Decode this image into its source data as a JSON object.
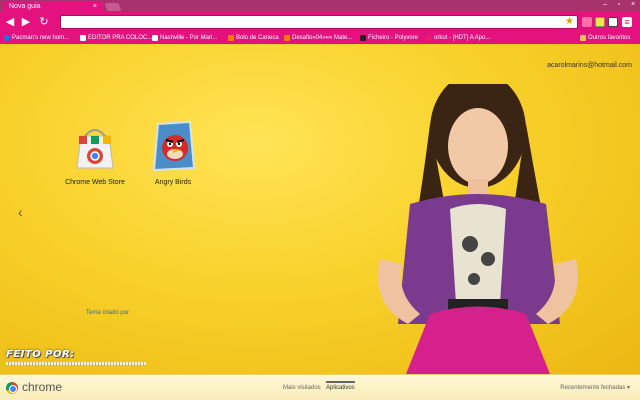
{
  "tabstrip": {
    "active_tab": "Nova guia",
    "close_glyph": "×",
    "window_controls": [
      "–",
      "▫",
      "×"
    ]
  },
  "toolbar": {
    "back_icon": "◀",
    "forward_icon": "▶",
    "reload_icon": "↻",
    "omnibox_value": "",
    "star_icon": "★"
  },
  "bookmarks": {
    "items": [
      {
        "label": "Pacman's new hom...",
        "favicon_color": "#1a73e8"
      },
      {
        "label": "EDITOR PRA COLOC...",
        "favicon_color": "#ffffff"
      },
      {
        "label": "Nashville - Por Mari...",
        "favicon_color": "#ffffff"
      },
      {
        "label": "Bolo de Caneca",
        "favicon_color": "#f57c00"
      },
      {
        "label": "Desafio«04»«« Mate...",
        "favicon_color": "#f57c00"
      },
      {
        "label": "Ficheiro - Polyvore",
        "favicon_color": "#222222"
      },
      {
        "label": "orkut - [HDT] A Apo...",
        "favicon_color": "#e91e63"
      }
    ],
    "other_label": "Outros favoritos"
  },
  "page": {
    "account": "acarolmarins@hotmail.com",
    "apps": [
      {
        "label": "Chrome Web Store",
        "icon": "chrome-web-store-icon"
      },
      {
        "label": "Angry Birds",
        "icon": "angry-birds-icon"
      }
    ],
    "prev_arrow": "‹",
    "theme_credit": "Tema criado por",
    "watermark": "FEITO POR:"
  },
  "bottombar": {
    "brand": "chrome",
    "tabs": [
      {
        "label": "Mais visitados",
        "active": false
      },
      {
        "label": "Aplicativos",
        "active": true
      }
    ],
    "recent": "Recentemente fechadas ▾"
  },
  "colors": {
    "accent": "#e3127f",
    "background": "#f5d021"
  }
}
